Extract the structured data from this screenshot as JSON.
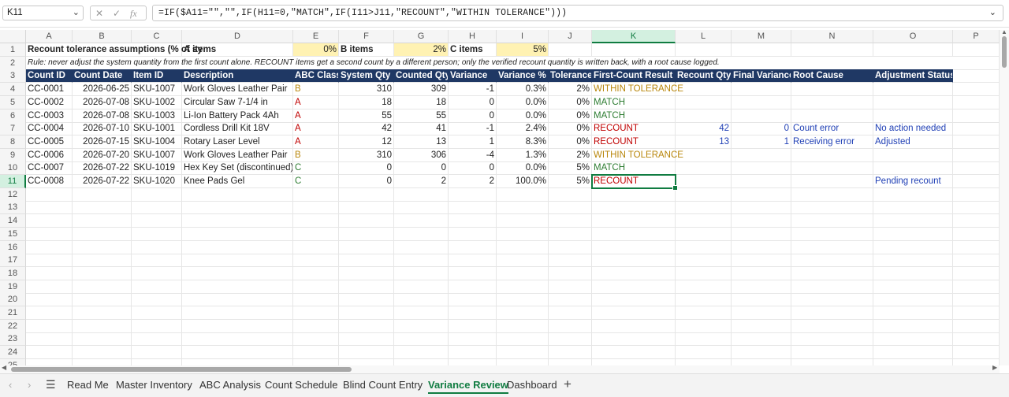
{
  "formula_bar": {
    "name_box": "K11",
    "formula": "=IF($A11=\"\",\"\",IF(H11=0,\"MATCH\",IF(I11>J11,\"RECOUNT\",\"WITHIN TOLERANCE\")))"
  },
  "columns": [
    "A",
    "B",
    "C",
    "D",
    "E",
    "F",
    "G",
    "H",
    "I",
    "J",
    "K",
    "L",
    "M",
    "N",
    "O",
    "P"
  ],
  "rows": [
    "1",
    "2",
    "3",
    "4",
    "5",
    "6",
    "7",
    "8",
    "9",
    "10",
    "11",
    "12",
    "13",
    "14",
    "15",
    "16",
    "17",
    "18",
    "19",
    "20",
    "21",
    "22",
    "23",
    "24",
    "25"
  ],
  "assumptions": {
    "label": "Recount tolerance assumptions (% of sy",
    "a_label": "A items",
    "a_value": "0%",
    "b_label": "B items",
    "b_value": "2%",
    "c_label": "C items",
    "c_value": "5%"
  },
  "rule_text": "Rule: never adjust the system quantity from the first count alone. RECOUNT items get a second count by a different person; only the verified recount quantity is written back, with a root cause logged.",
  "headers": [
    "Count ID",
    "Count Date",
    "Item ID",
    "Description",
    "ABC Class",
    "System Qty",
    "Counted Qty",
    "Variance",
    "Variance %",
    "Tolerance",
    "First-Count Result",
    "Recount Qty",
    "Final Variance",
    "Root Cause",
    "Adjustment Status"
  ],
  "table_rows": [
    [
      "CC-0001",
      "2026-06-25",
      "SKU-1007",
      "Work Gloves Leather Pair",
      "B",
      "310",
      "309",
      "-1",
      "0.3%",
      "2%",
      "WITHIN TOLERANCE",
      "",
      "",
      "",
      ""
    ],
    [
      "CC-0002",
      "2026-07-08",
      "SKU-1002",
      "Circular Saw 7-1/4 in",
      "A",
      "18",
      "18",
      "0",
      "0.0%",
      "0%",
      "MATCH",
      "",
      "",
      "",
      ""
    ],
    [
      "CC-0003",
      "2026-07-08",
      "SKU-1003",
      "Li-Ion Battery Pack 4Ah",
      "A",
      "55",
      "55",
      "0",
      "0.0%",
      "0%",
      "MATCH",
      "",
      "",
      "",
      ""
    ],
    [
      "CC-0004",
      "2026-07-10",
      "SKU-1001",
      "Cordless Drill Kit 18V",
      "A",
      "42",
      "41",
      "-1",
      "2.4%",
      "0%",
      "RECOUNT",
      "42",
      "0",
      "Count error",
      "No action needed"
    ],
    [
      "CC-0005",
      "2026-07-15",
      "SKU-1004",
      "Rotary Laser Level",
      "A",
      "12",
      "13",
      "1",
      "8.3%",
      "0%",
      "RECOUNT",
      "13",
      "1",
      "Receiving error",
      "Adjusted"
    ],
    [
      "CC-0006",
      "2026-07-20",
      "SKU-1007",
      "Work Gloves Leather Pair",
      "B",
      "310",
      "306",
      "-4",
      "1.3%",
      "2%",
      "WITHIN TOLERANCE",
      "",
      "",
      "",
      ""
    ],
    [
      "CC-0007",
      "2026-07-22",
      "SKU-1019",
      "Hex Key Set (discontinued)",
      "C",
      "0",
      "0",
      "0",
      "0.0%",
      "5%",
      "MATCH",
      "",
      "",
      "",
      ""
    ],
    [
      "CC-0008",
      "2026-07-22",
      "SKU-1020",
      "Knee Pads Gel",
      "C",
      "0",
      "2",
      "2",
      "100.0%",
      "5%",
      "RECOUNT",
      "",
      "",
      "",
      "Pending recount"
    ]
  ],
  "sheet_tabs": [
    "Read Me",
    "Master Inventory",
    "ABC Analysis",
    "Count Schedule",
    "Blind Count Entry",
    "Variance Review",
    "Dashboard"
  ],
  "active_tab": "Variance Review",
  "colors": {
    "accent": "#107c41",
    "header_bg": "#1f3864",
    "assumption_fill": "#fff2b3",
    "class_a": "#c00000",
    "class_b": "#b8860b",
    "class_c": "#2e7d32",
    "input_blue": "#1f3fb5"
  },
  "icons": {
    "cancel": "close-icon",
    "enter": "check-icon",
    "function": "fx-icon",
    "sheet_list": "menu-icon",
    "add_sheet": "plus-icon"
  }
}
